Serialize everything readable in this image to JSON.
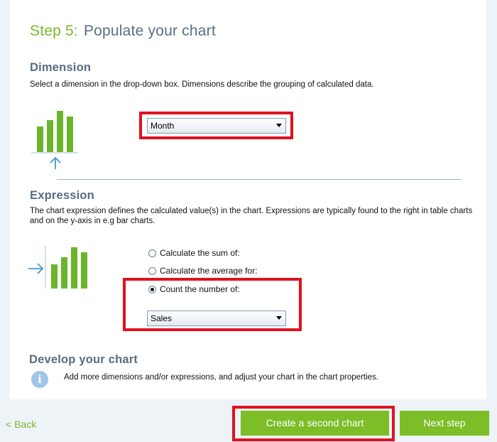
{
  "header": {
    "step_number": "Step 5:",
    "step_title": "Populate your chart"
  },
  "dimension": {
    "title": "Dimension",
    "description": "Select a dimension in the drop-down box. Dimensions describe the grouping of calculated data.",
    "selected_value": "Month"
  },
  "expression": {
    "title": "Expression",
    "description": "The chart expression defines the calculated value(s) in the chart. Expressions are typically found to the right in table charts and on the y-axis in e.g bar charts.",
    "options": [
      {
        "label": "Calculate the sum of:",
        "checked": false
      },
      {
        "label": "Calculate the average for:",
        "checked": false
      },
      {
        "label": "Count the number of:",
        "checked": true
      }
    ],
    "selected_field": "Sales"
  },
  "develop": {
    "title": "Develop your chart",
    "info_icon_glyph": "i",
    "text": "Add more dimensions and/or expressions, and adjust your chart in the chart properties."
  },
  "footer": {
    "back_label": "< Back",
    "create_second_label": "Create a second chart",
    "next_label": "Next step"
  },
  "colors": {
    "accent_green": "#7cbd28",
    "bar_green": "#6bb52a",
    "highlight_red": "#e0121e",
    "heading_slate": "#5a6c80",
    "arrow_blue": "#3a9ad9"
  }
}
